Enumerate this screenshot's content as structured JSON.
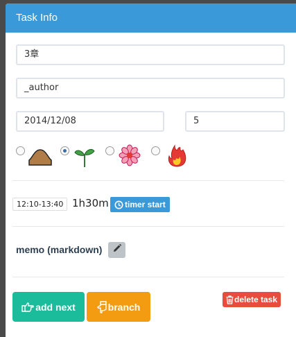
{
  "panel": {
    "title": "Task Info"
  },
  "fields": {
    "title_value": "3章",
    "author_value": "_author",
    "date_value": "2014/12/08",
    "number_value": "5"
  },
  "status_options": [
    {
      "icon": "mound-icon",
      "checked": false
    },
    {
      "icon": "sprout-icon",
      "checked": true
    },
    {
      "icon": "flower-icon",
      "checked": false
    },
    {
      "icon": "fire-icon",
      "checked": false
    }
  ],
  "timer": {
    "range": "12:10-13:40",
    "duration": "1h30m",
    "start_label": "timer start",
    "start_icon": "clock-icon"
  },
  "memo": {
    "label": "memo (markdown)",
    "edit_icon": "pencil-icon"
  },
  "actions": {
    "add_next_label": "add next",
    "add_next_icon": "hand-point-right-icon",
    "branch_label": "branch",
    "branch_icon": "hand-point-down-icon",
    "delete_label": "delete task",
    "delete_icon": "trash-icon"
  },
  "colors": {
    "header": "#3a9ad9",
    "add_next": "#1abc9c",
    "branch": "#f39c12",
    "delete": "#e74c3c",
    "timer_button": "#3a9ad9"
  }
}
